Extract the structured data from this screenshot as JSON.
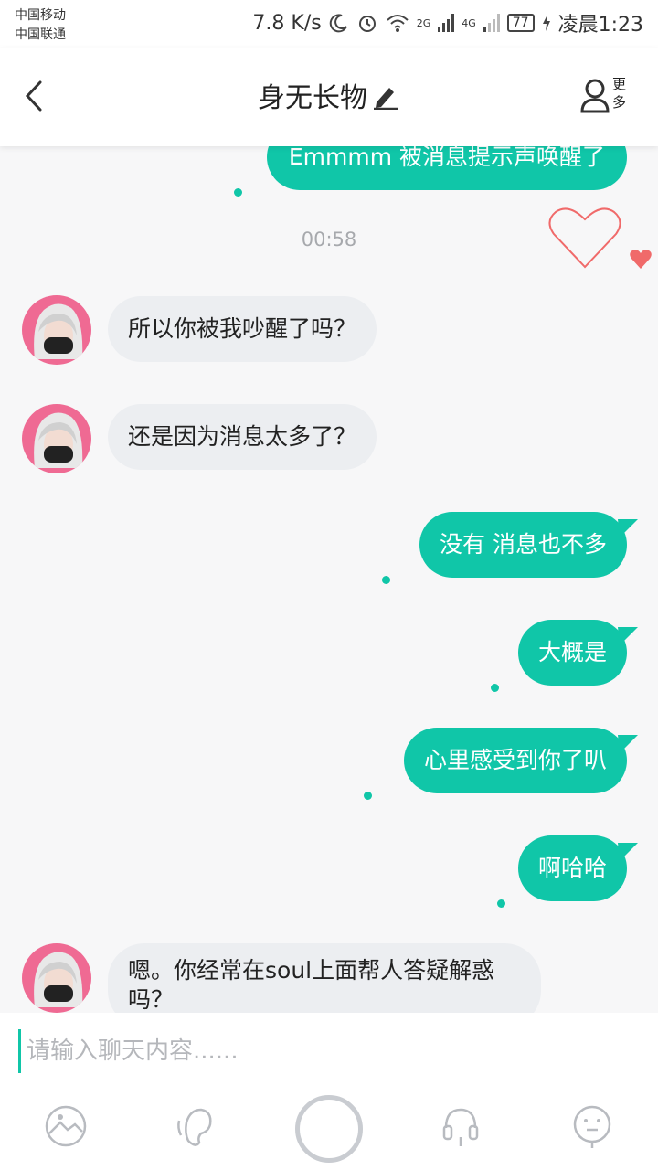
{
  "status_bar": {
    "carrier1": "中国移动",
    "carrier2": "中国联通",
    "speed": "7.8 K/s",
    "net_2g": "2G",
    "net_4g": "4G",
    "battery": "77",
    "time": "凌晨1:23"
  },
  "header": {
    "title": "身无长物",
    "more_label": "更多"
  },
  "chat": {
    "messages": [
      {
        "side": "out",
        "text": "Emmmm 被消息提示声唤醒了"
      },
      {
        "side": "time",
        "text": "00:58"
      },
      {
        "side": "in",
        "text": "所以你被我吵醒了吗？"
      },
      {
        "side": "in",
        "text": "还是因为消息太多了？"
      },
      {
        "side": "out",
        "text": "没有 消息也不多"
      },
      {
        "side": "out",
        "text": "大概是"
      },
      {
        "side": "out",
        "text": "心里感受到你了叭"
      },
      {
        "side": "out",
        "text": "啊哈哈"
      },
      {
        "side": "in",
        "text": "嗯。你经常在soul上面帮人答疑解惑吗？"
      }
    ]
  },
  "input": {
    "placeholder": "请输入聊天内容......"
  },
  "colors": {
    "accent": "#10c6a8",
    "incoming_bubble": "#eceef1",
    "heart": "#f06a6a"
  },
  "icons": [
    "back-arrow-icon",
    "edit-pencil-icon",
    "user-more-icon",
    "heart-outline-icon",
    "heart-filled-icon",
    "image-icon",
    "ear-icon",
    "mic-ring-icon",
    "headset-icon",
    "emoji-icon"
  ]
}
